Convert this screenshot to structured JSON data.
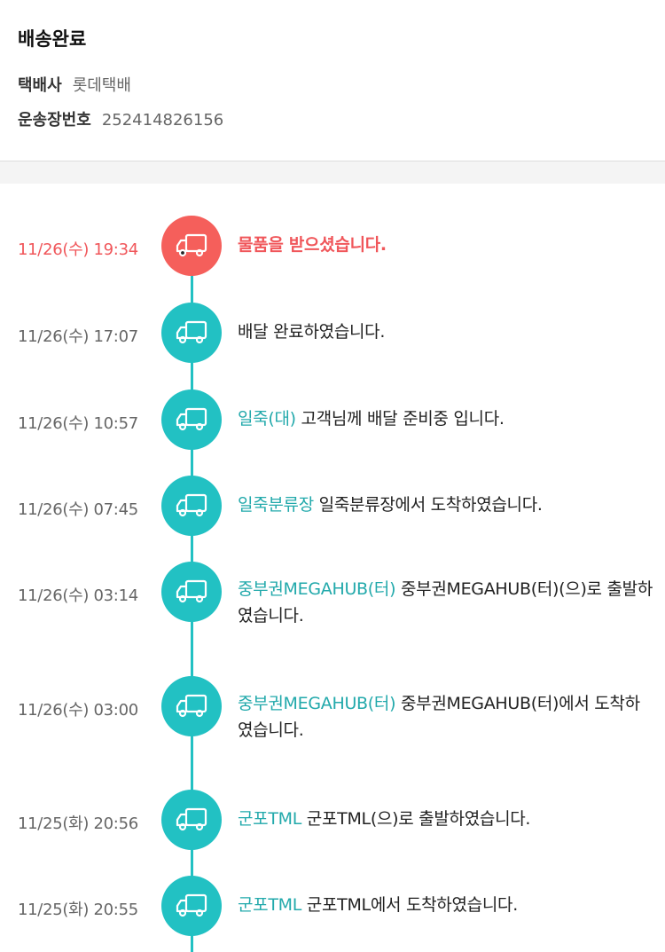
{
  "header": {
    "status": "배송완료",
    "courier_label": "택배사",
    "courier_value": "롯데택배",
    "tracking_label": "운송장번호",
    "tracking_value": "252414826156"
  },
  "colors": {
    "accent": "#22c1c3",
    "highlight": "#f55f5b"
  },
  "events": [
    {
      "time": "11/26(수) 19:34",
      "location": "",
      "message": "물품을 받으셨습니다.",
      "icon": "delivery-truck-icon"
    },
    {
      "time": "11/26(수) 17:07",
      "location": "",
      "message": "배달 완료하였습니다.",
      "icon": "delivery-truck-icon"
    },
    {
      "time": "11/26(수) 10:57",
      "location": "일죽(대)",
      "message": "고객님께 배달 준비중 입니다.",
      "icon": "delivery-truck-icon"
    },
    {
      "time": "11/26(수) 07:45",
      "location": "일죽분류장",
      "message": "일죽분류장에서 도착하였습니다.",
      "icon": "delivery-truck-icon"
    },
    {
      "time": "11/26(수) 03:14",
      "location": "중부권MEGAHUB(터)",
      "message": "중부권MEGAHUB(터)(으)로 출발하였습니다.",
      "icon": "delivery-truck-icon"
    },
    {
      "time": "11/26(수) 03:00",
      "location": "중부권MEGAHUB(터)",
      "message": "중부권MEGAHUB(터)에서 도착하였습니다.",
      "icon": "delivery-truck-icon"
    },
    {
      "time": "11/25(화) 20:56",
      "location": "군포TML",
      "message": "군포TML(으)로 출발하였습니다.",
      "icon": "delivery-truck-icon"
    },
    {
      "time": "11/25(화) 20:55",
      "location": "군포TML",
      "message": "군포TML에서 도착하였습니다.",
      "icon": "delivery-truck-icon"
    }
  ]
}
